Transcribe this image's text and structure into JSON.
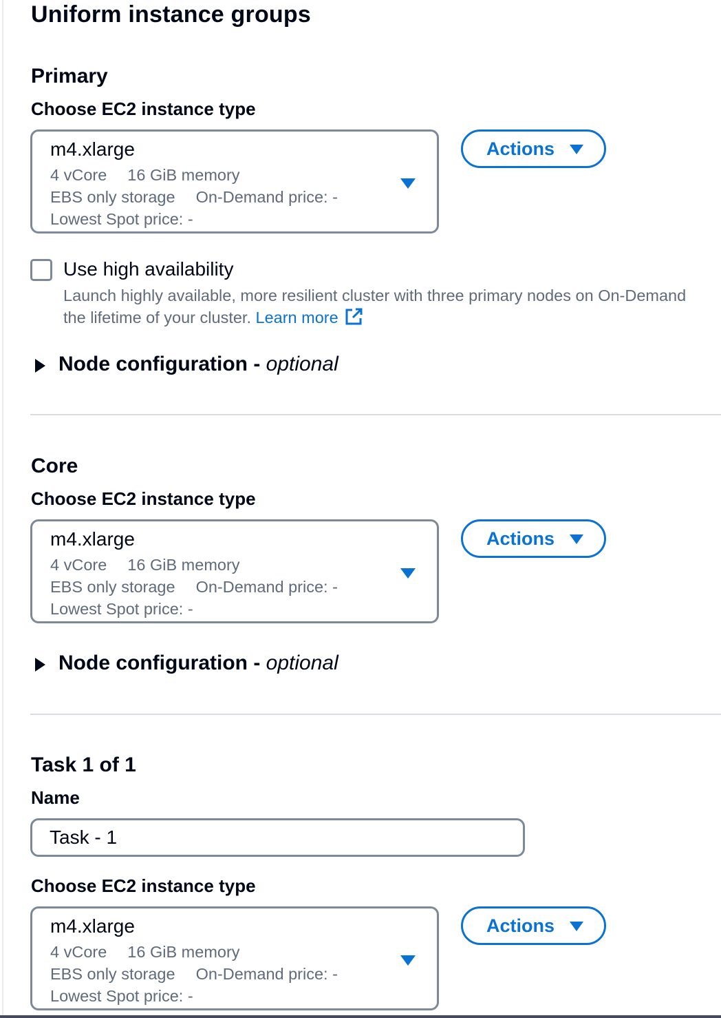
{
  "page": {
    "title": "Uniform instance groups"
  },
  "primary": {
    "title": "Primary",
    "instance_label": "Choose EC2 instance type",
    "instance": {
      "type": "m4.xlarge",
      "vcore": "4 vCore",
      "memory": "16 GiB memory",
      "storage": "EBS only storage",
      "on_demand": "On-Demand price: -",
      "spot": "Lowest Spot price: -"
    },
    "actions_label": "Actions",
    "high_availability": {
      "label": "Use high availability",
      "checked": false,
      "description_line1": "Launch highly available, more resilient cluster with three primary nodes on On-Demand",
      "description_line2": "the lifetime of your cluster.",
      "learn_more": "Learn more"
    },
    "node_config": {
      "label": "Node configuration - ",
      "optional": "optional"
    }
  },
  "core": {
    "title": "Core",
    "instance_label": "Choose EC2 instance type",
    "instance": {
      "type": "m4.xlarge",
      "vcore": "4 vCore",
      "memory": "16 GiB memory",
      "storage": "EBS only storage",
      "on_demand": "On-Demand price: -",
      "spot": "Lowest Spot price: -"
    },
    "actions_label": "Actions",
    "node_config": {
      "label": "Node configuration - ",
      "optional": "optional"
    }
  },
  "task": {
    "title": "Task 1 of 1",
    "name_label": "Name",
    "name_value": "Task - 1",
    "instance_label": "Choose EC2 instance type",
    "instance": {
      "type": "m4.xlarge",
      "vcore": "4 vCore",
      "memory": "16 GiB memory",
      "storage": "EBS only storage",
      "on_demand": "On-Demand price: -",
      "spot": "Lowest Spot price: -"
    },
    "actions_label": "Actions"
  },
  "colors": {
    "link_blue": "#0972d3",
    "text": "#000716",
    "secondary_text": "#5f6b7a",
    "border": "#7d8998"
  },
  "icons": {
    "external_link": "external-link-icon",
    "dropdown": "caret-down-icon",
    "expand": "caret-right-icon"
  }
}
